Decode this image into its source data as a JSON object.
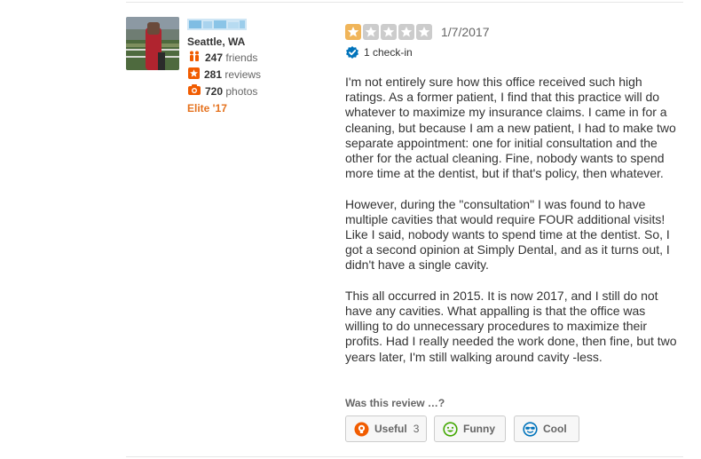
{
  "user": {
    "location": "Seattle, WA",
    "friends_count": "247",
    "friends_label": "friends",
    "reviews_count": "281",
    "reviews_label": "reviews",
    "photos_count": "720",
    "photos_label": "photos",
    "elite": "Elite '17"
  },
  "review": {
    "rating": 1,
    "rating_max": 5,
    "date": "1/7/2017",
    "checkin": "1 check-in",
    "paragraphs": [
      "I'm not entirely sure how this office received such high ratings. As a former patient, I find that this practice will do whatever to maximize my insurance claims. I came in for a cleaning, but because I am a new patient, I had to make two separate appointment: one for initial consultation and the other for the actual cleaning. Fine, nobody wants to spend more time at the dentist, but if that's policy, then whatever.",
      "However, during the \"consultation\" I was found to have multiple cavities that would require FOUR additional visits! Like I said, nobody wants to spend time at the dentist. So, I got a second opinion at Simply Dental, and as it turns out, I didn't have a single cavity.",
      "This all occurred in 2015. It is now 2017, and I still do not have any cavities. What appalling is that the office was willing to do unnecessary procedures to maximize their profits. Had I really needed the work done, then fine, but two years later, I'm still walking around cavity -less."
    ]
  },
  "feedback": {
    "label": "Was this review …?",
    "useful_label": "Useful",
    "useful_count": "3",
    "funny_label": "Funny",
    "cool_label": "Cool"
  },
  "colors": {
    "star_active": "#f0b55a",
    "star_inactive": "#cccccc",
    "elite": "#e5721e",
    "friends_icon": "#f15c00",
    "reviews_icon": "#f15c00",
    "photos_icon": "#f15c00",
    "checkin_badge": "#0073bb",
    "useful_icon": "#f15c00",
    "funny_icon": "#41a700",
    "cool_icon": "#0073bb"
  },
  "icons": [
    "friends-icon",
    "reviews-star-icon",
    "camera-icon",
    "check-badge-icon",
    "lightbulb-icon",
    "smiley-icon",
    "sunglasses-icon"
  ]
}
